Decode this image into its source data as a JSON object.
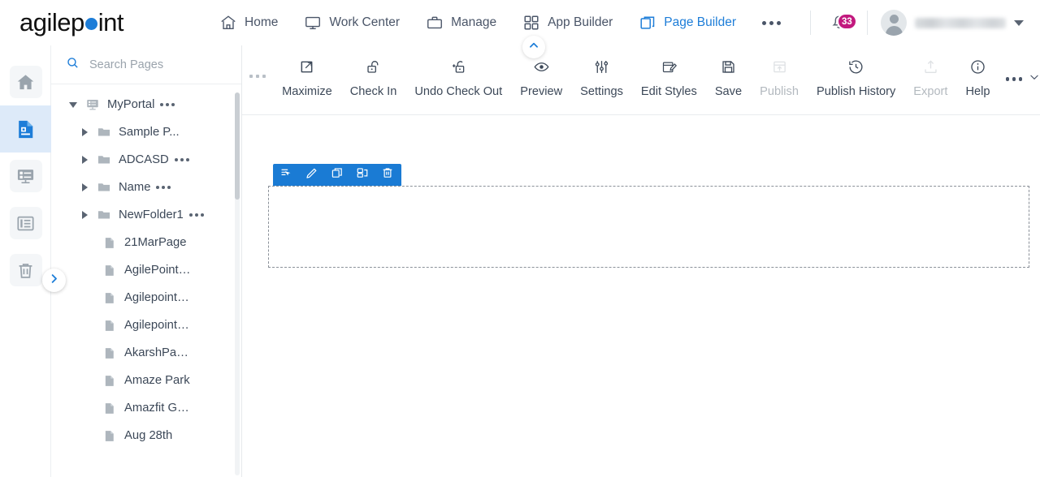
{
  "brand": {
    "name_part1": "agilep",
    "name_part2": "int",
    "accent": "#1d7dd8"
  },
  "header": {
    "nav": [
      {
        "label": "Home",
        "icon": "home-icon",
        "active": false
      },
      {
        "label": "Work Center",
        "icon": "monitor-icon",
        "active": false
      },
      {
        "label": "Manage",
        "icon": "briefcase-icon",
        "active": false
      },
      {
        "label": "App Builder",
        "icon": "grid-icon",
        "active": false
      },
      {
        "label": "Page Builder",
        "icon": "pages-icon",
        "active": true
      }
    ],
    "overflow_icon": "ellipsis-icon",
    "notifications": {
      "icon": "bell-icon",
      "count": "33",
      "badge_color": "#c2197e"
    },
    "user": {
      "name": "",
      "avatar_icon": "user-avatar-icon",
      "caret_icon": "chevron-down-icon"
    }
  },
  "rail": {
    "items": [
      {
        "icon": "home-icon",
        "name": "rail-item-home",
        "active": false
      },
      {
        "icon": "page-icon",
        "name": "rail-item-pages",
        "active": true
      },
      {
        "icon": "form-icon",
        "name": "rail-item-forms",
        "active": false
      },
      {
        "icon": "layout-icon",
        "name": "rail-item-layouts",
        "active": false
      },
      {
        "icon": "trash-icon",
        "name": "rail-item-recycle-bin",
        "active": false
      }
    ],
    "collapse_icon": "chevron-right-icon"
  },
  "tree": {
    "search": {
      "icon": "search-icon",
      "placeholder": "Search Pages",
      "value": ""
    },
    "items": [
      {
        "label": "MyPortal",
        "level": 0,
        "type": "portal",
        "expanded": true,
        "arrow": "down",
        "menu": true
      },
      {
        "label": "Sample P...",
        "level": 1,
        "type": "folder",
        "expanded": false,
        "arrow": "right",
        "menu": false
      },
      {
        "label": "ADCASD",
        "level": 1,
        "type": "folder",
        "expanded": false,
        "arrow": "right",
        "menu": true
      },
      {
        "label": "Name",
        "level": 1,
        "type": "folder",
        "expanded": false,
        "arrow": "right",
        "menu": true
      },
      {
        "label": "NewFolder1",
        "level": 1,
        "type": "folder",
        "expanded": false,
        "arrow": "right",
        "menu": true
      },
      {
        "label": "21MarPage",
        "level": 2,
        "type": "page",
        "expanded": false,
        "arrow": "none",
        "menu": false
      },
      {
        "label": "AgilePoint…",
        "level": 2,
        "type": "page",
        "expanded": false,
        "arrow": "none",
        "menu": false
      },
      {
        "label": "Agilepoint…",
        "level": 2,
        "type": "page",
        "expanded": false,
        "arrow": "none",
        "menu": false
      },
      {
        "label": "Agilepoint…",
        "level": 2,
        "type": "page",
        "expanded": false,
        "arrow": "none",
        "menu": false
      },
      {
        "label": "AkarshPa…",
        "level": 2,
        "type": "page",
        "expanded": false,
        "arrow": "none",
        "menu": false
      },
      {
        "label": "Amaze Park",
        "level": 2,
        "type": "page",
        "expanded": false,
        "arrow": "none",
        "menu": false
      },
      {
        "label": "Amazfit G…",
        "level": 2,
        "type": "page",
        "expanded": false,
        "arrow": "none",
        "menu": false
      },
      {
        "label": "Aug 28th",
        "level": 2,
        "type": "page",
        "expanded": false,
        "arrow": "none",
        "menu": false
      }
    ]
  },
  "toolbar": {
    "drag_handle": "drag-handle-icon",
    "buttons": [
      {
        "label": "Maximize",
        "icon": "maximize-icon",
        "disabled": false
      },
      {
        "label": "Check In",
        "icon": "unlock-icon",
        "disabled": false
      },
      {
        "label": "Undo Check Out",
        "icon": "lock-undo-icon",
        "disabled": false
      },
      {
        "label": "Preview",
        "icon": "eye-icon",
        "disabled": false
      },
      {
        "label": "Settings",
        "icon": "sliders-icon",
        "disabled": false
      },
      {
        "label": "Edit Styles",
        "icon": "edit-styles-icon",
        "disabled": false
      },
      {
        "label": "Save",
        "icon": "save-icon",
        "disabled": false
      },
      {
        "label": "Publish",
        "icon": "publish-icon",
        "disabled": true
      },
      {
        "label": "Publish History",
        "icon": "history-icon",
        "disabled": false
      },
      {
        "label": "Export",
        "icon": "export-icon",
        "disabled": true
      },
      {
        "label": "Help",
        "icon": "info-icon",
        "disabled": false
      }
    ],
    "more_icon": "ellipsis-icon",
    "more_caret_icon": "chevron-down-icon",
    "collapse_icon": "chevron-up-icon"
  },
  "canvas": {
    "widget_toolbar": [
      {
        "icon": "move-select-icon",
        "name": "widget-select-button"
      },
      {
        "icon": "pencil-icon",
        "name": "widget-edit-button"
      },
      {
        "icon": "copy-icon",
        "name": "widget-copy-button"
      },
      {
        "icon": "duplicate-icon",
        "name": "widget-duplicate-button"
      },
      {
        "icon": "trash-icon",
        "name": "widget-delete-button"
      }
    ],
    "dropzone_label": ""
  }
}
